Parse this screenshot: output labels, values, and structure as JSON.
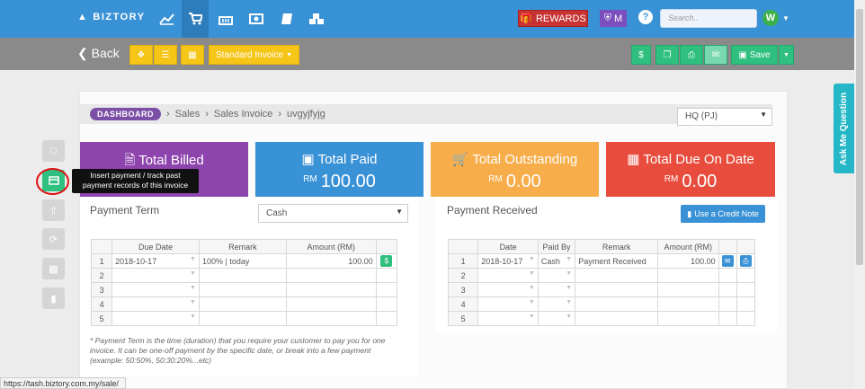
{
  "nav": {
    "brand": "BIZTORY",
    "rewards_label": "REWARDS",
    "m_label": "M",
    "help_label": "?",
    "search_placeholder": "Search..",
    "avatar_letter": "W"
  },
  "toolbar": {
    "back_label": "Back",
    "standard_invoice_label": "Standard Invoice",
    "dollar_label": "$",
    "save_label": "Save"
  },
  "breadcrumb": {
    "dashboard": "DASHBOARD",
    "items": [
      "Sales",
      "Sales Invoice",
      "uvgyjfyjg"
    ]
  },
  "branch_select": "HQ (PJ)",
  "cards": [
    {
      "title": "Total Billed",
      "currency": "",
      "value": "",
      "color": "#8e44ad"
    },
    {
      "title": "Total Paid",
      "currency": "RM",
      "value": "100.00",
      "color": "#3a92d6"
    },
    {
      "title": "Total Outstanding",
      "currency": "RM",
      "value": "0.00",
      "color": "#f7ad4a"
    },
    {
      "title": "Total Due On Date",
      "currency": "RM",
      "value": "0.00",
      "color": "#e74c3c"
    }
  ],
  "tooltip": {
    "line1": "Insert payment / track past",
    "line2": "payment records of this invoice"
  },
  "payment_term": {
    "title": "Payment Term",
    "select_value": "Cash",
    "headers": [
      "",
      "Due Date",
      "Remark",
      "Amount (RM)",
      ""
    ],
    "rows": [
      {
        "no": "1",
        "date": "2018-10-17",
        "remark": "100% | today",
        "amount": "100.00"
      },
      {
        "no": "2",
        "date": "",
        "remark": "",
        "amount": ""
      },
      {
        "no": "3",
        "date": "",
        "remark": "",
        "amount": ""
      },
      {
        "no": "4",
        "date": "",
        "remark": "",
        "amount": ""
      },
      {
        "no": "5",
        "date": "",
        "remark": "",
        "amount": ""
      }
    ],
    "note": "* Payment Term is the time (duration) that you require your customer to pay you for one invoice. It can be one-off payment by the specific date, or break into a few payment (example: 50:50%, 50:30:20%...etc)"
  },
  "payment_received": {
    "title": "Payment Received",
    "credit_note_label": "Use a Credit Note",
    "headers": [
      "",
      "Date",
      "Paid By",
      "Remark",
      "Amount (RM)",
      "",
      ""
    ],
    "rows": [
      {
        "no": "1",
        "date": "2018-10-17",
        "paid_by": "Cash",
        "remark": "Payment Received",
        "amount": "100.00"
      },
      {
        "no": "2",
        "date": "",
        "paid_by": "",
        "remark": "",
        "amount": ""
      },
      {
        "no": "3",
        "date": "",
        "paid_by": "",
        "remark": "",
        "amount": ""
      },
      {
        "no": "4",
        "date": "",
        "paid_by": "",
        "remark": "",
        "amount": ""
      },
      {
        "no": "5",
        "date": "",
        "paid_by": "",
        "remark": "",
        "amount": ""
      }
    ]
  },
  "ask_me_label": "Ask Me Question",
  "status_url": "https://tash.biztory.com.my/sale/"
}
